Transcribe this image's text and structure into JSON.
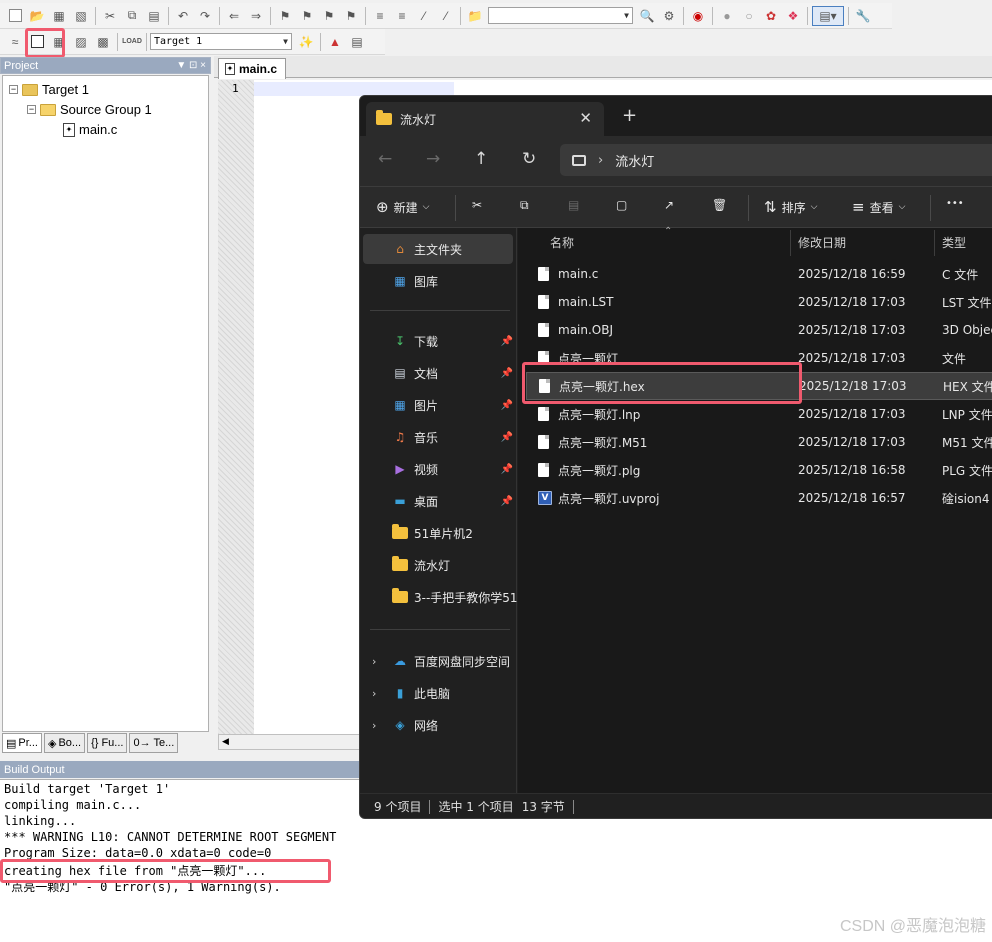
{
  "ide": {
    "target_combo": "Target 1",
    "project_panel": {
      "title": "Project",
      "pin": "↓ ↧ ×"
    },
    "tree": {
      "target": "Target 1",
      "group": "Source Group 1",
      "file": "main.c"
    },
    "project_tabs": [
      "Pr...",
      "Bo...",
      "{} Fu...",
      "0→ Te..."
    ],
    "editor": {
      "tab": "main.c",
      "line": "1"
    },
    "build_output": {
      "title": "Build Output",
      "lines": [
        "Build target 'Target 1'",
        "compiling main.c...",
        "linking...",
        "*** WARNING L10: CANNOT DETERMINE ROOT SEGMENT",
        "Program Size: data=0.0 xdata=0 code=0",
        "creating hex file from \"点亮一颗灯\"...",
        "\"点亮一颗灯\" - 0 Error(s), 1 Warning(s)."
      ]
    }
  },
  "explorer": {
    "tab_title": "流水灯",
    "close": "✕",
    "new_tab": "+",
    "breadcrumb": "流水灯",
    "toolbar": {
      "new": "新建",
      "sort": "排序",
      "view": "查看",
      "more": "•••"
    },
    "nav": [
      {
        "label": "主文件夹",
        "icon": "home-icon"
      },
      {
        "label": "图库",
        "icon": "gallery-icon"
      },
      {
        "label": "下载",
        "icon": "download-icon"
      },
      {
        "label": "文档",
        "icon": "document-icon"
      },
      {
        "label": "图片",
        "icon": "pictures-icon"
      },
      {
        "label": "音乐",
        "icon": "music-icon"
      },
      {
        "label": "视频",
        "icon": "video-icon"
      },
      {
        "label": "桌面",
        "icon": "desktop-icon"
      },
      {
        "label": "51单片机2",
        "icon": "folder-icon"
      },
      {
        "label": "流水灯",
        "icon": "folder-icon"
      },
      {
        "label": "3--手把手教你学51",
        "icon": "folder-icon"
      },
      {
        "label": "百度网盘同步空间",
        "icon": "baidu-cloud-icon"
      },
      {
        "label": "此电脑",
        "icon": "computer-icon"
      },
      {
        "label": "网络",
        "icon": "network-icon"
      }
    ],
    "columns": {
      "name": "名称",
      "date": "修改日期",
      "type": "类型"
    },
    "files": [
      {
        "name": "main.c",
        "date": "2025/12/18 16:59",
        "type": "C 文件"
      },
      {
        "name": "main.LST",
        "date": "2025/12/18 17:03",
        "type": "LST 文件"
      },
      {
        "name": "main.OBJ",
        "date": "2025/12/18 17:03",
        "type": "3D Objec"
      },
      {
        "name": "点亮一颗灯",
        "date": "2025/12/18 17:03",
        "type": "文件"
      },
      {
        "name": "点亮一颗灯.hex",
        "date": "2025/12/18 17:03",
        "type": "HEX 文件"
      },
      {
        "name": "点亮一颗灯.lnp",
        "date": "2025/12/18 17:03",
        "type": "LNP 文件"
      },
      {
        "name": "点亮一颗灯.M51",
        "date": "2025/12/18 17:03",
        "type": "M51 文件"
      },
      {
        "name": "点亮一颗灯.plg",
        "date": "2025/12/18 16:58",
        "type": "PLG 文件"
      },
      {
        "name": "点亮一颗灯.uvproj",
        "date": "2025/12/18 16:57",
        "type": "碒ision4"
      }
    ],
    "status": {
      "count": "9 个项目",
      "selected": "选中 1 个项目",
      "size": "13 字节"
    }
  },
  "watermark": "CSDN @恶魔泡泡糖",
  "colors": {
    "highlight": "#f05a6e",
    "explorer_bg": "#202020"
  }
}
